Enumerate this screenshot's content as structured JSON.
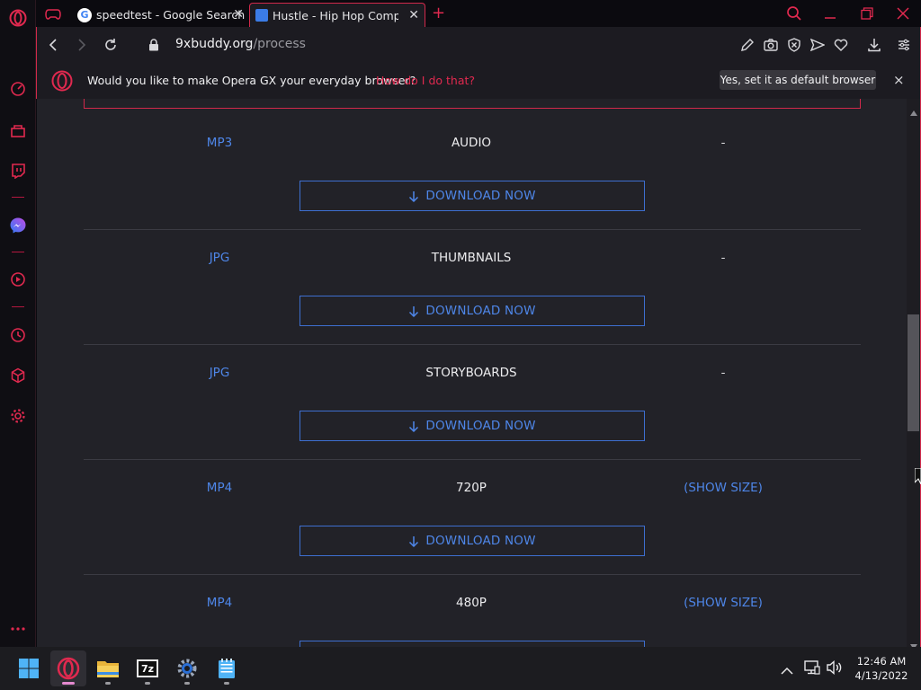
{
  "browser": {
    "tabs": [
      {
        "label": "speedtest - Google Search",
        "icon": "google-icon"
      },
      {
        "label": "Hustle - Hip Hop Competit",
        "icon": "page-icon",
        "active": true
      }
    ],
    "new_tab_symbol": "+",
    "url_domain": "9xbuddy.org",
    "url_path": "/process"
  },
  "notification": {
    "message": "Would you like to make Opera GX your everyday browser?",
    "link": "How do I do that?",
    "button": "Yes, set it as default browser",
    "close": "×"
  },
  "downloads": {
    "button_label": "DOWNLOAD NOW",
    "rows": [
      {
        "format": "MP3",
        "quality": "AUDIO",
        "size": "-"
      },
      {
        "format": "JPG",
        "quality": "THUMBNAILS",
        "size": "-"
      },
      {
        "format": "JPG",
        "quality": "STORYBOARDS",
        "size": "-"
      },
      {
        "format": "MP4",
        "quality": "720P",
        "size": "(SHOW SIZE)"
      },
      {
        "format": "MP4",
        "quality": "480P",
        "size": "(SHOW SIZE)"
      }
    ]
  },
  "taskbar": {
    "time": "12:46 AM",
    "date": "4/13/2022",
    "apps": [
      "windows-start",
      "opera-gx",
      "file-explorer",
      "7zip",
      "settings",
      "notepad"
    ]
  },
  "colors": {
    "accent": "#d1294b",
    "link": "#4e86e8",
    "bg": "#222228"
  }
}
